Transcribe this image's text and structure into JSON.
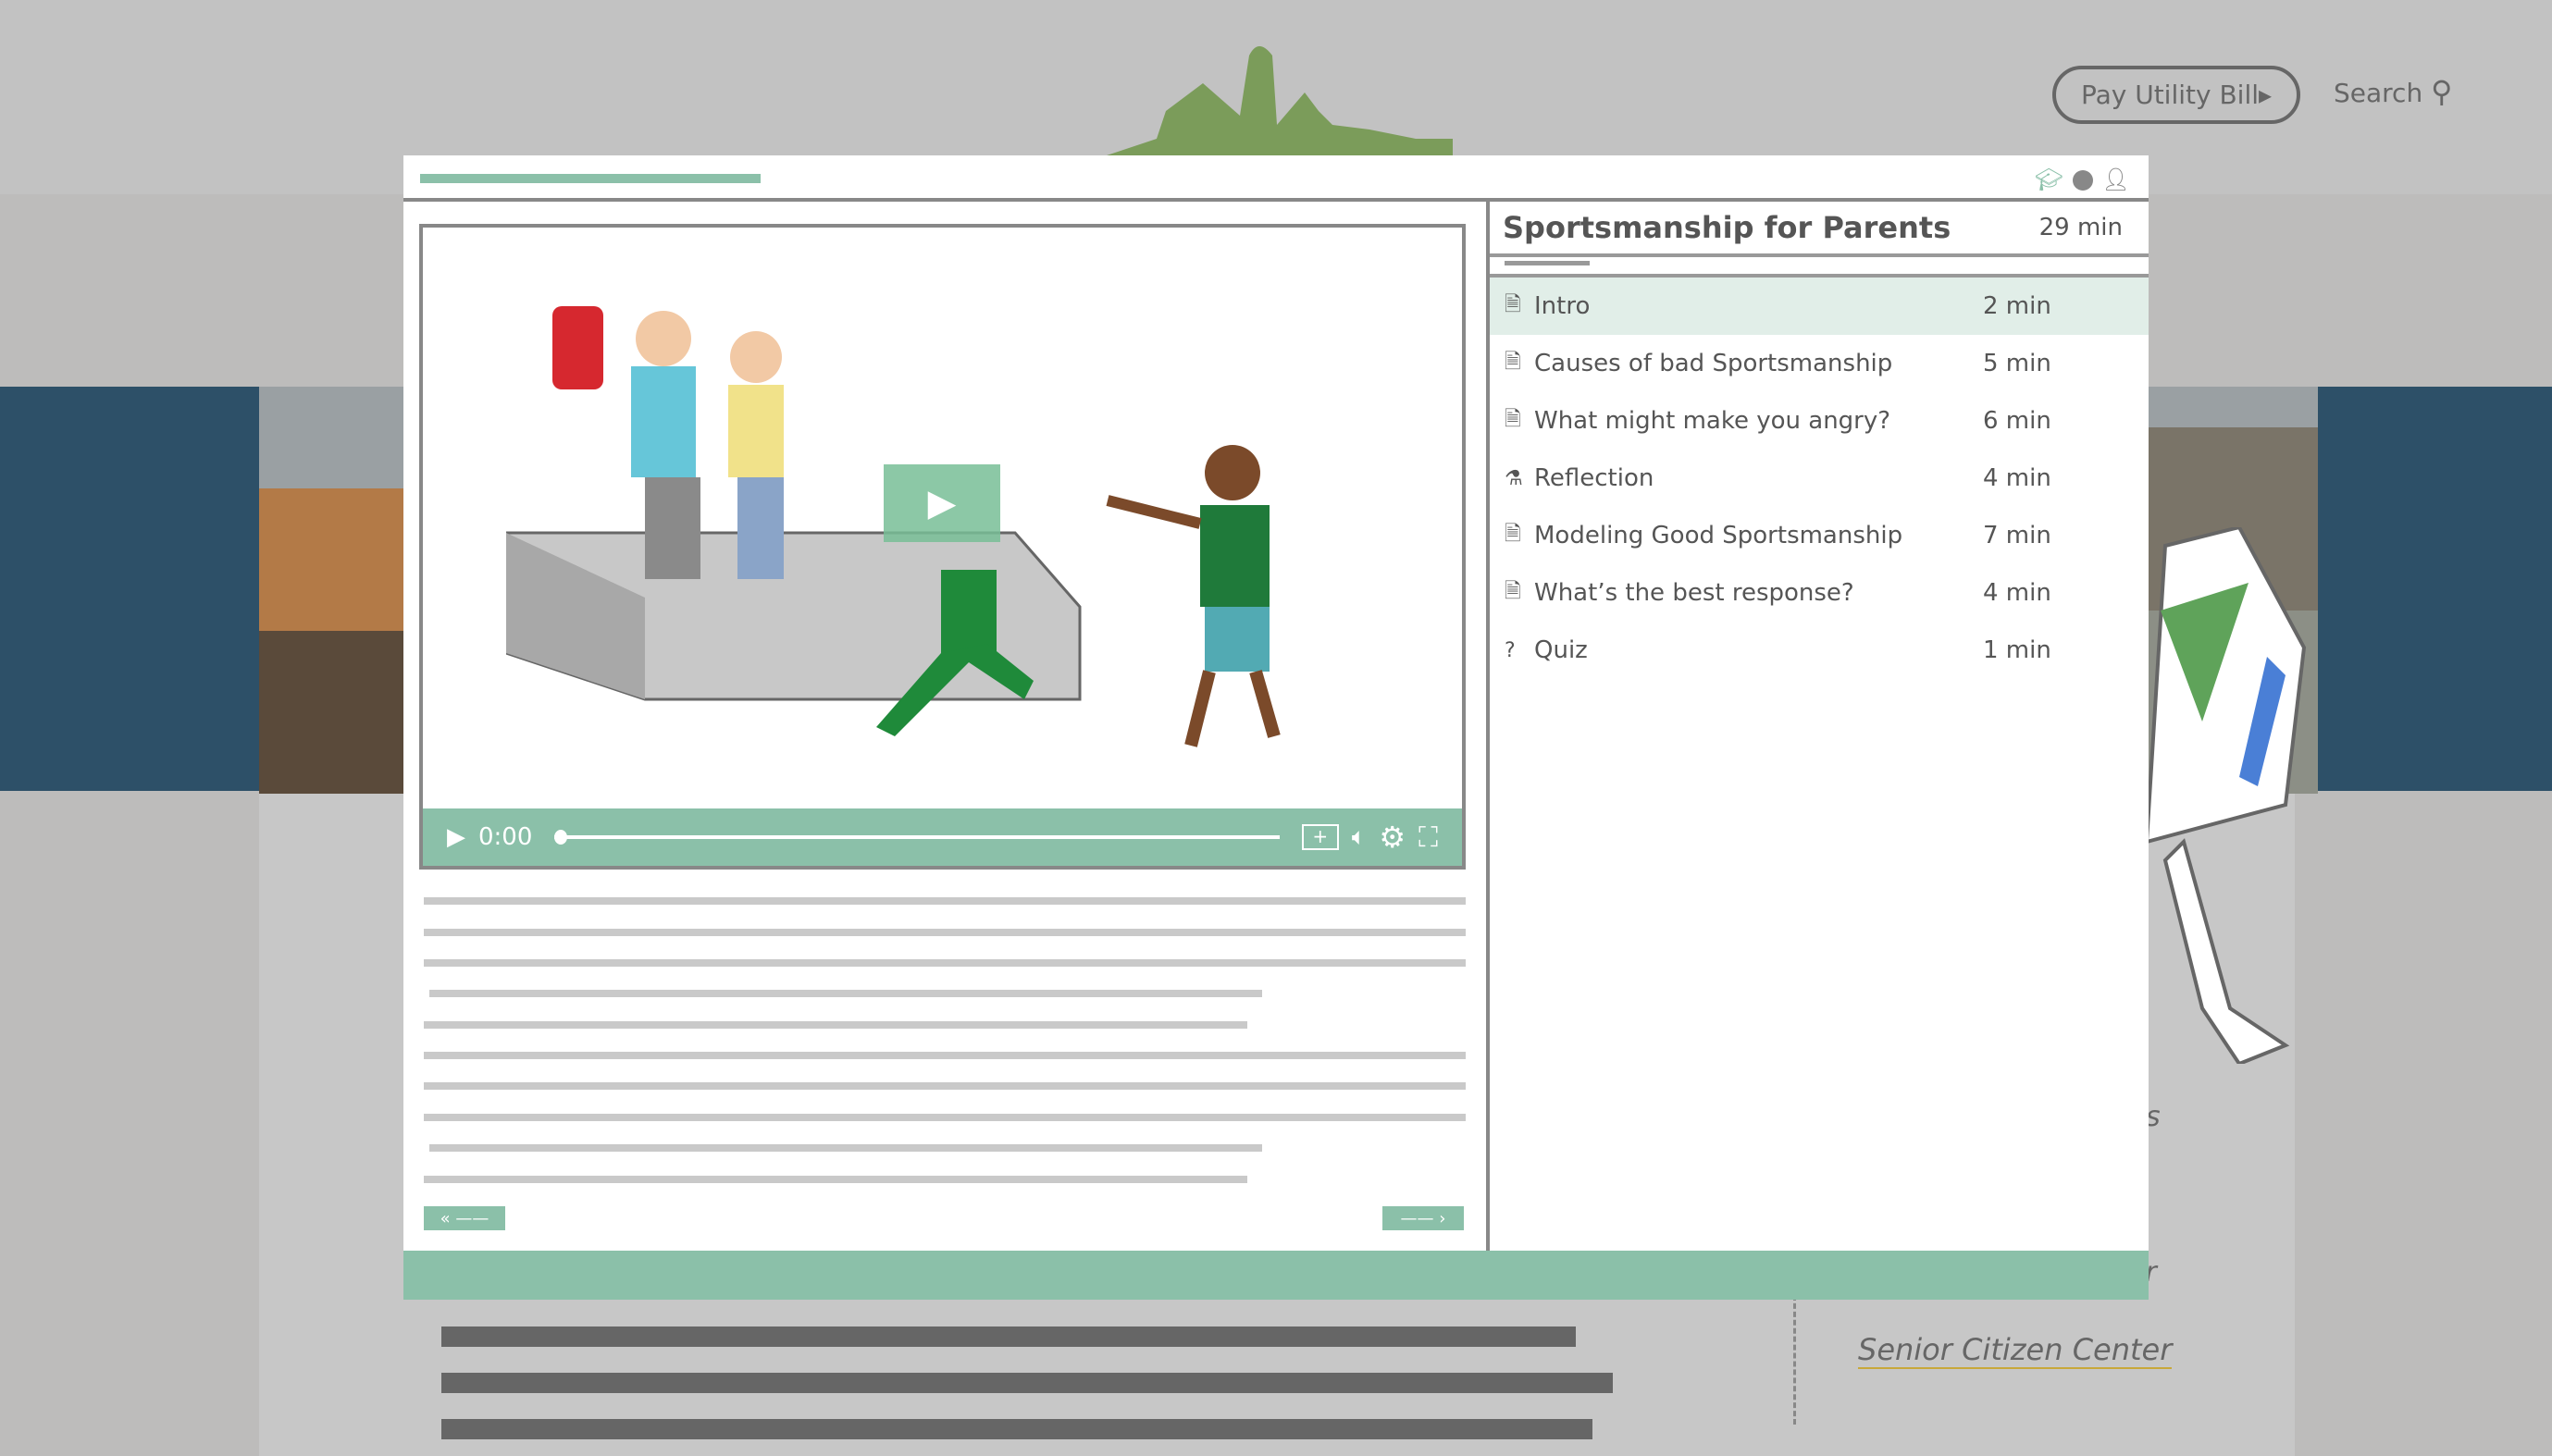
{
  "header": {
    "pay_bill": "Pay Utility Bill",
    "search": "Search"
  },
  "background": {
    "link_fragments": [
      "ns",
      "er"
    ],
    "senior_link": "Senior Citizen Center"
  },
  "course": {
    "title": "Sportsmanship for Parents",
    "duration": "29 min",
    "lessons": [
      {
        "icon": "document-icon",
        "label": "Intro",
        "duration": "2 min",
        "active": true
      },
      {
        "icon": "document-icon",
        "label": "Causes of bad Sportsmanship",
        "duration": "5 min"
      },
      {
        "icon": "video-document-icon",
        "label": "What might make you angry?",
        "duration": "6 min"
      },
      {
        "icon": "flask-icon",
        "label": "Reflection",
        "duration": "4 min"
      },
      {
        "icon": "document-icon",
        "label": "Modeling Good Sportsmanship",
        "duration": "7 min"
      },
      {
        "icon": "video-document-icon",
        "label": "What’s the best response?",
        "duration": "4 min"
      },
      {
        "icon": "question-icon",
        "label": "Quiz",
        "duration": "1 min"
      }
    ]
  },
  "player": {
    "time": "0:00",
    "progress": 0
  },
  "colors": {
    "accent": "#8bc0a9",
    "band": "#2d5068"
  }
}
